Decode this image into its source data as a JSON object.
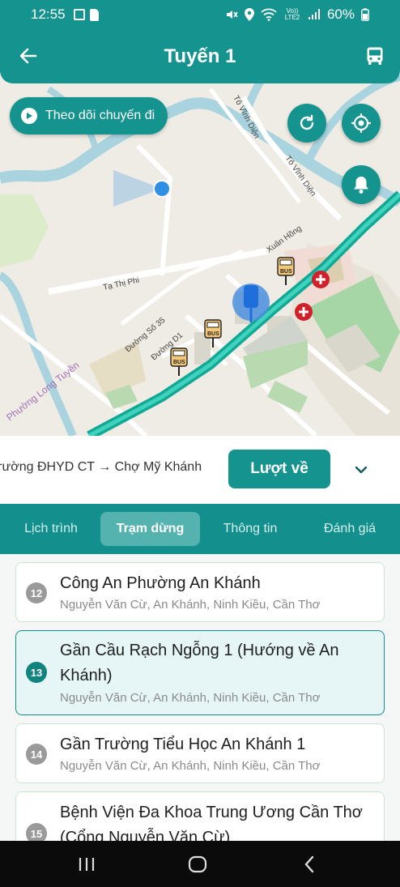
{
  "status_bar": {
    "time": "12:55",
    "network": "Vo)) LTE2",
    "battery": "60%"
  },
  "header": {
    "title": "Tuyến 1",
    "back_icon": "arrow-left-icon",
    "bus_icon": "bus-icon"
  },
  "map": {
    "track_button_label": "Theo dõi chuyến đi",
    "labels": {
      "to_vinh_dien_1": "Tô Vĩnh Diện",
      "to_vinh_dien_2": "Tô Vĩnh Diện",
      "xuan_hong": "Xuân Hồng",
      "ta_thi_phi": "Tạ Thị Phi",
      "duong_so_35": "Đường Số 35",
      "duong_d1": "Đường D1",
      "duong_d1b": "Đường D1",
      "phuong_long_tuyen": "Phường Long Tuyền",
      "bus_sign": "BUS"
    }
  },
  "route": {
    "direction_text": "Trường ĐHYD CT → Chợ Mỹ Khánh",
    "return_button": "Lượt về"
  },
  "tabs": [
    {
      "label": "Lịch trình"
    },
    {
      "label": "Trạm dừng"
    },
    {
      "label": "Thông tin"
    },
    {
      "label": "Đánh giá"
    }
  ],
  "stops": [
    {
      "number": "12",
      "name": "Công An Phường An Khánh",
      "address": "Nguyễn Văn Cừ, An Khánh, Ninh Kiều, Cần Thơ"
    },
    {
      "number": "13",
      "name": "Gần Cầu Rạch Ngỗng 1 (Hướng về An Khánh)",
      "address": "Nguyễn Văn Cừ, An Khánh, Ninh Kiều, Cần Thơ"
    },
    {
      "number": "14",
      "name": "Gần Trường Tiểu Học An Khánh 1",
      "address": "Nguyễn Văn Cừ, An Khánh, Ninh Kiều, Cần Thơ"
    },
    {
      "number": "15",
      "name": "Bệnh Viện Đa Khoa Trung Ương Cần Thơ (Cổng Nguyễn Văn Cừ)",
      "address": ""
    }
  ],
  "colors": {
    "primary": "#14938f",
    "active_tab": "#54b3ae",
    "active_card_bg": "#e6f6f6",
    "route_line": "#1fb9a5",
    "hospital": "#d0202a"
  }
}
